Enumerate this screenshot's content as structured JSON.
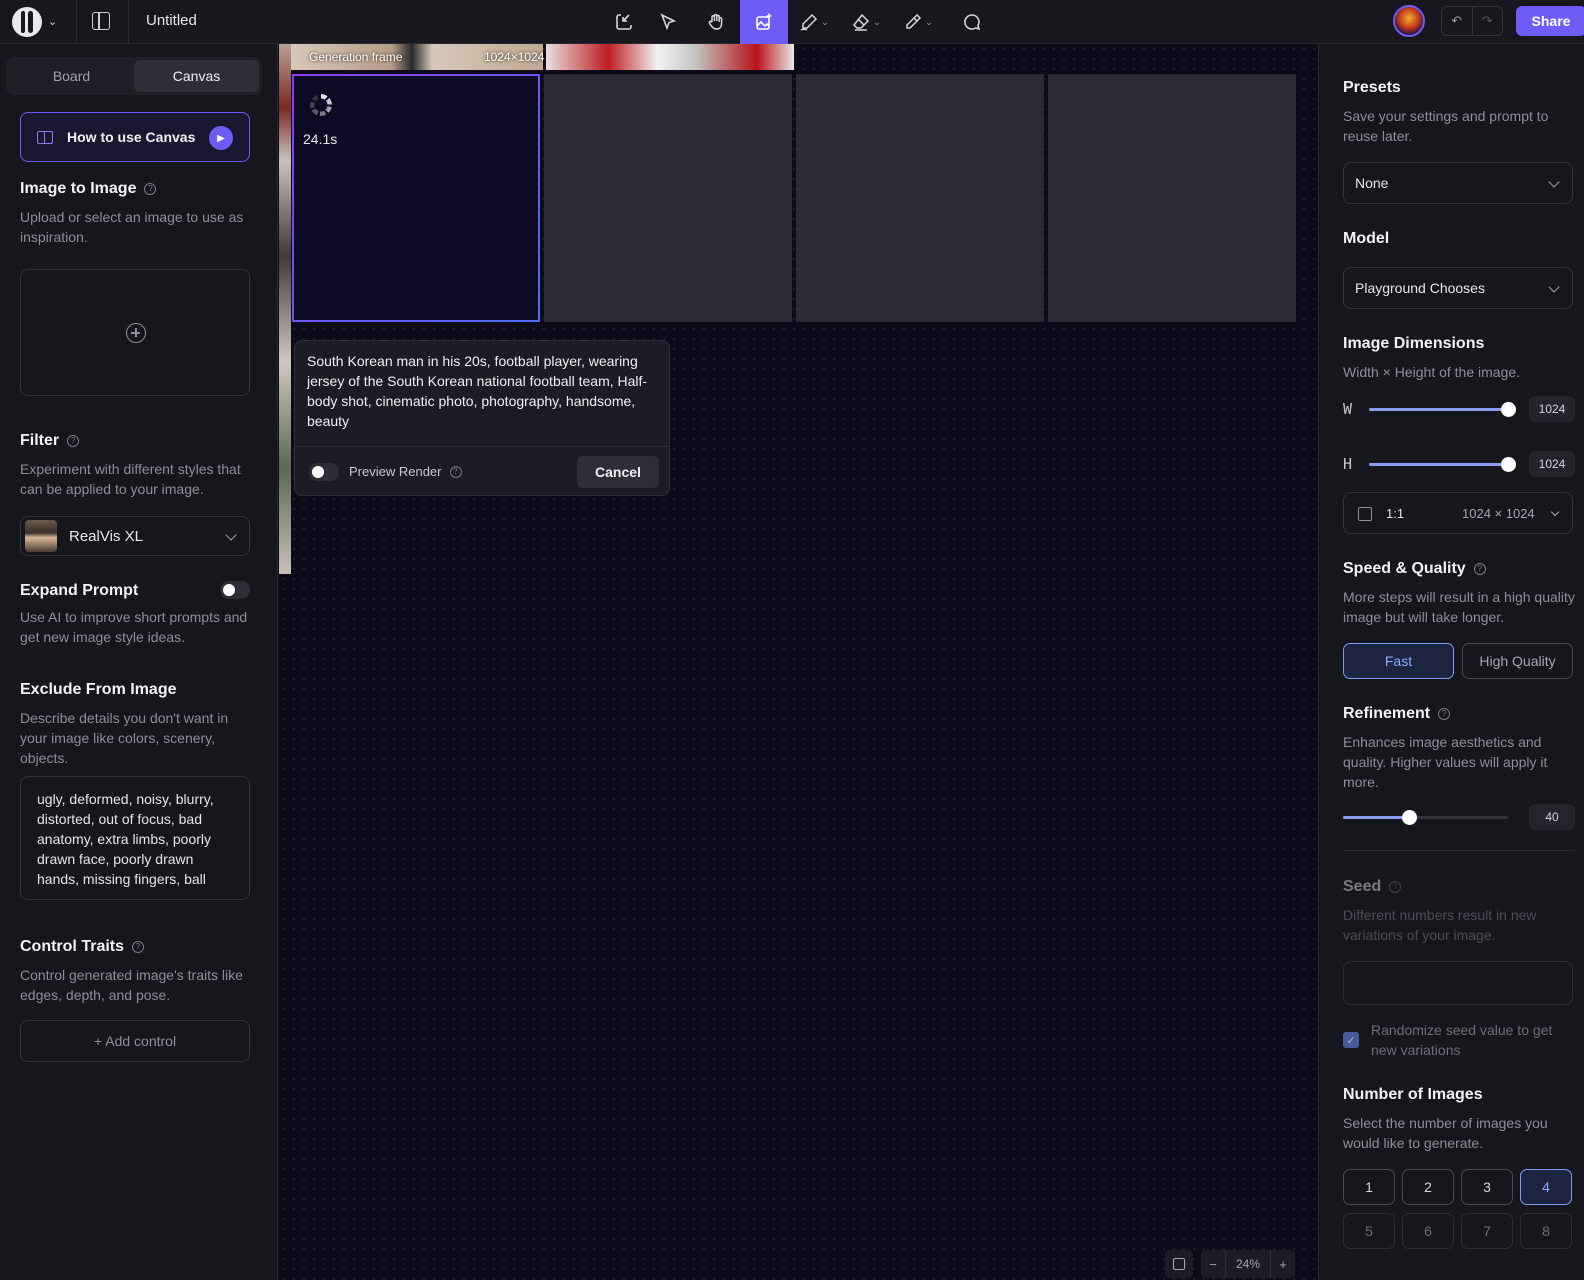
{
  "header": {
    "title": "Untitled",
    "share_label": "Share",
    "undo_icon": "undo-icon",
    "redo_icon": "redo-icon"
  },
  "left_panel": {
    "tabs": [
      "Board",
      "Canvas"
    ],
    "active_tab": "Canvas",
    "how_to_label": "How to use Canvas",
    "image_to_image": {
      "title": "Image to Image",
      "desc": "Upload or select an image to use as inspiration."
    },
    "filter": {
      "title": "Filter",
      "desc": "Experiment with different styles that can be applied to your image.",
      "selected": "RealVis XL"
    },
    "expand_prompt": {
      "title": "Expand Prompt",
      "desc": "Use AI to improve short prompts and get new image style ideas.",
      "enabled": false
    },
    "exclude": {
      "title": "Exclude From Image",
      "desc": "Describe details you don't want in your image like colors, scenery, objects.",
      "value": "ugly, deformed, noisy, blurry, distorted, out of focus, bad anatomy, extra limbs, poorly drawn face, poorly drawn hands, missing fingers, ball"
    },
    "control_traits": {
      "title": "Control Traits",
      "desc": "Control generated image's traits like edges, depth, and pose.",
      "add_label": "+ Add control"
    }
  },
  "canvas": {
    "frame_label": "Generation frame",
    "frame_size": "1024×1024",
    "timer": "24.1s",
    "prompt": "South Korean man in his 20s, football player, wearing jersey of the South Korean national football team, Half-body shot, cinematic photo, photography, handsome, beauty",
    "preview_render_label": "Preview Render",
    "cancel_label": "Cancel",
    "zoom": "24%"
  },
  "right_panel": {
    "presets": {
      "title": "Presets",
      "desc": "Save your settings and prompt to reuse later.",
      "selected": "None"
    },
    "model": {
      "title": "Model",
      "selected": "Playground Chooses"
    },
    "dimensions": {
      "title": "Image Dimensions",
      "desc": "Width × Height of the image.",
      "w_label": "W",
      "h_label": "H",
      "width": "1024",
      "height": "1024",
      "width_fraction": 1.0,
      "height_fraction": 1.0,
      "ratio": "1:1",
      "ratio_dims": "1024 × 1024"
    },
    "speed_quality": {
      "title": "Speed & Quality",
      "desc": "More steps will result in a high quality image but will take longer.",
      "options": [
        "Fast",
        "High Quality"
      ],
      "selected": "Fast"
    },
    "refinement": {
      "title": "Refinement",
      "desc": "Enhances image aesthetics and quality. Higher values will apply it more.",
      "value": "40",
      "fraction": 0.4
    },
    "seed": {
      "title": "Seed",
      "desc": "Different numbers result in new variations of your image.",
      "randomize_label": "Randomize seed value to get new variations",
      "randomize": true
    },
    "num_images": {
      "title": "Number of Images",
      "desc": "Select the number of images you would like to generate.",
      "options": [
        "1",
        "2",
        "3",
        "4",
        "5",
        "6",
        "7",
        "8"
      ],
      "selected": "4"
    }
  },
  "colors": {
    "accent": "#6d5cf6",
    "selected_blue": "#7b9cf6",
    "panel_bg": "#16161d",
    "canvas_bg": "#0d0b1a"
  }
}
